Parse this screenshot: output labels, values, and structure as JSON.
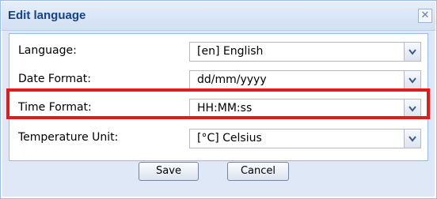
{
  "dialog": {
    "title": "Edit language",
    "close_glyph": "✕"
  },
  "form": {
    "rows": [
      {
        "label": "Language:",
        "value": "[en] English"
      },
      {
        "label": "Date Format:",
        "value": "dd/mm/yyyy"
      },
      {
        "label": "Time Format:",
        "value": "HH:MM:ss"
      },
      {
        "label": "Temperature Unit:",
        "value": "[°C] Celsius"
      }
    ]
  },
  "buttons": {
    "save_label": "Save",
    "cancel_label": "Cancel"
  },
  "colors": {
    "highlight": "#e41b1b",
    "title_text": "#15428b",
    "window_border": "#99bbe8"
  },
  "icons": {
    "close": "close-icon",
    "dropdown": "chevron-down-icon"
  }
}
